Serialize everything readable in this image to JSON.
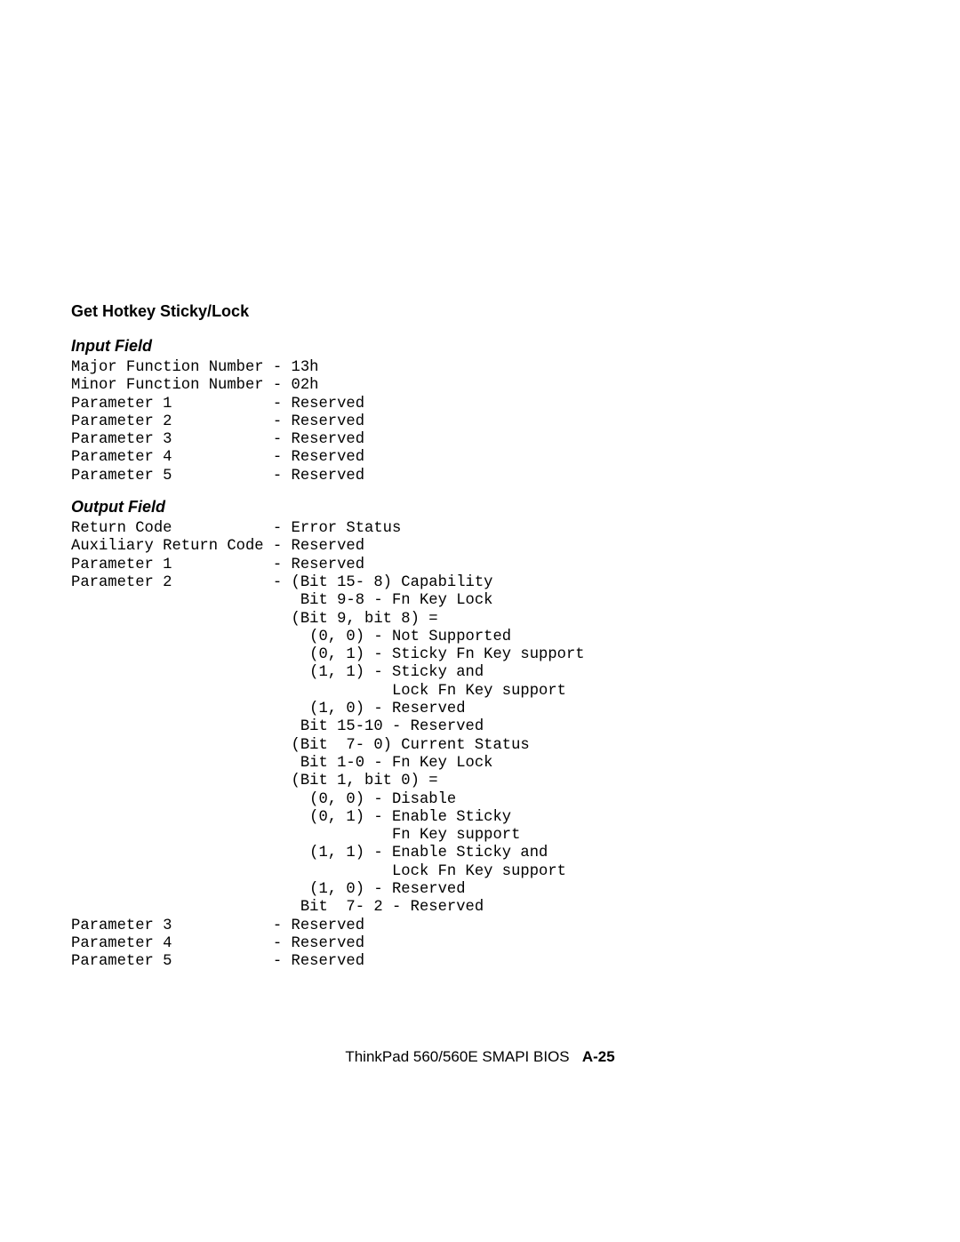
{
  "section_title": "Get Hotkey Sticky/Lock",
  "input_heading": "Input Field",
  "input_block": "Major Function Number - 13h\nMinor Function Number - 02h\nParameter 1           - Reserved\nParameter 2           - Reserved\nParameter 3           - Reserved\nParameter 4           - Reserved\nParameter 5           - Reserved",
  "output_heading": "Output Field",
  "output_block": "Return Code           - Error Status\nAuxiliary Return Code - Reserved\nParameter 1           - Reserved\nParameter 2           - (Bit 15- 8) Capability\n                         Bit 9-8 - Fn Key Lock\n                        (Bit 9, bit 8) =\n                          (0, 0) - Not Supported\n                          (0, 1) - Sticky Fn Key support\n                          (1, 1) - Sticky and\n                                   Lock Fn Key support\n                          (1, 0) - Reserved\n                         Bit 15-10 - Reserved\n                        (Bit  7- 0) Current Status\n                         Bit 1-0 - Fn Key Lock\n                        (Bit 1, bit 0) =\n                          (0, 0) - Disable\n                          (0, 1) - Enable Sticky\n                                   Fn Key support\n                          (1, 1) - Enable Sticky and\n                                   Lock Fn Key support\n                          (1, 0) - Reserved\n                         Bit  7- 2 - Reserved\nParameter 3           - Reserved\nParameter 4           - Reserved\nParameter 5           - Reserved",
  "footer_plain": "ThinkPad 560/560E SMAPI BIOS",
  "footer_bold": "A-25"
}
